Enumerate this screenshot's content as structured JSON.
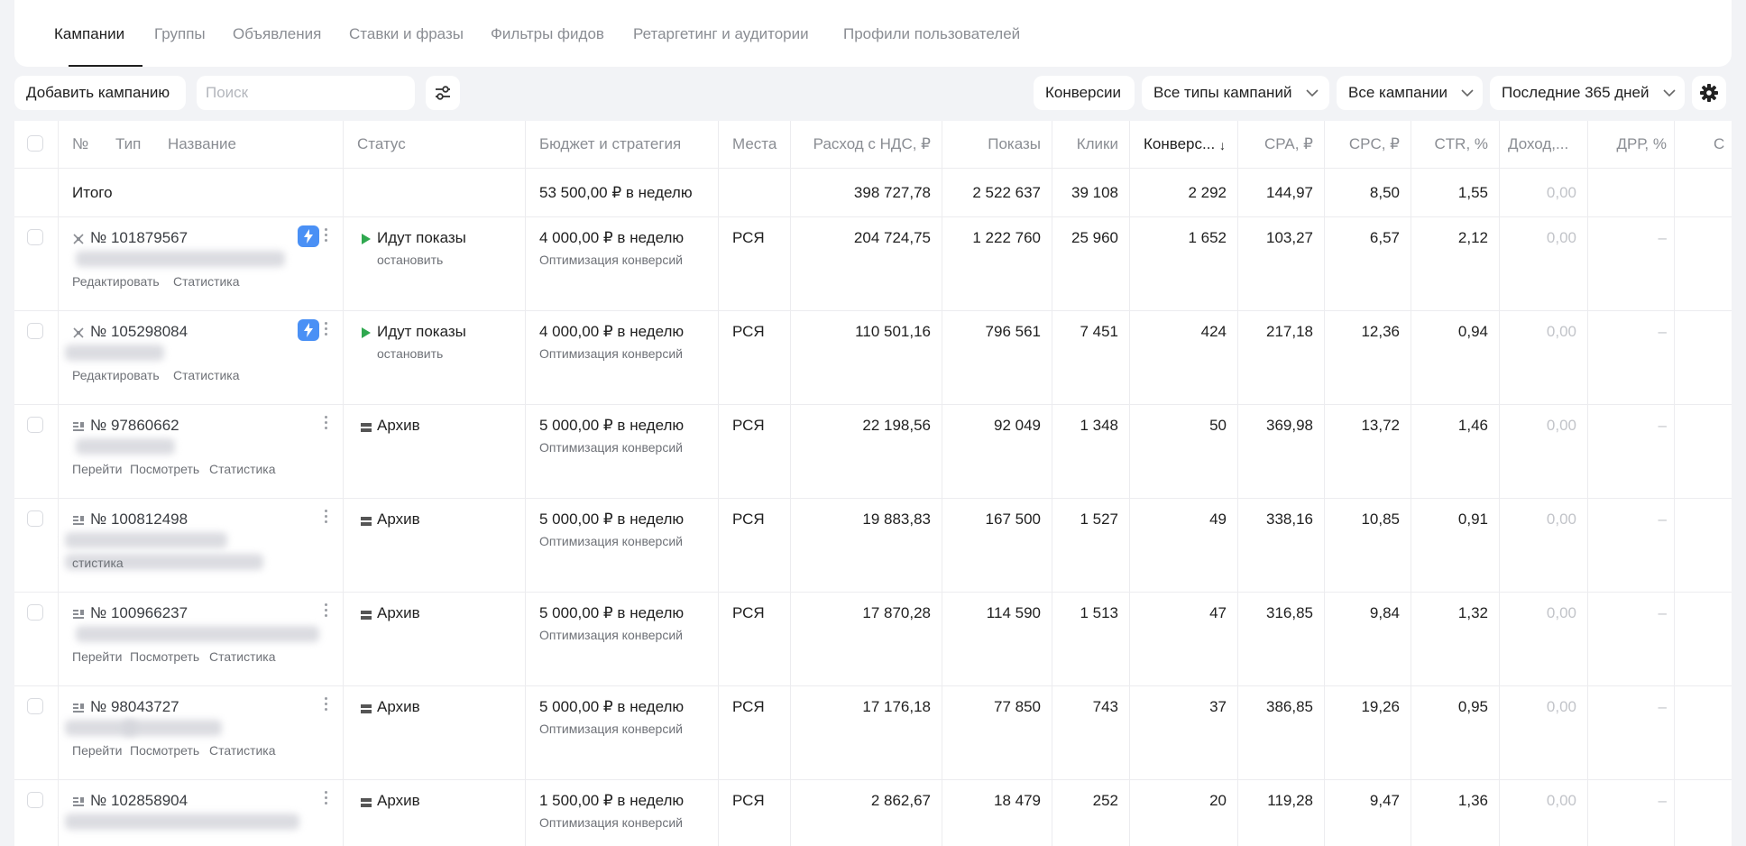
{
  "tabs": [
    "Кампании",
    "Группы",
    "Объявления",
    "Ставки и фразы",
    "Фильтры фидов",
    "Ретаргетинг и аудитории",
    "Профили пользователей"
  ],
  "toolbar": {
    "add_campaign": "Добавить кампанию",
    "search_placeholder": "Поиск",
    "conversions": "Конверсии",
    "campaign_types": "Все типы кампаний",
    "campaigns_filter": "Все кампании",
    "period": "Последние 365 дней"
  },
  "columns": {
    "num": "№",
    "type": "Тип",
    "name": "Название",
    "status": "Статус",
    "budget": "Бюджет и стратегия",
    "places": "Места",
    "spend": "Расход с НДС, ₽",
    "impressions": "Показы",
    "clicks": "Клики",
    "conversions": "Конверс...",
    "sort_arrow": "↓",
    "cpa": "CPA, ₽",
    "cpc": "CPC, ₽",
    "ctr": "CTR, %",
    "income": "Доход,...",
    "drr": "ДРР, %",
    "more": "С"
  },
  "totals": {
    "label": "Итого",
    "budget": "53 500,00 ₽ в неделю",
    "spend": "398 727,78",
    "impressions": "2 522 637",
    "clicks": "39 108",
    "conversions": "2 292",
    "cpa": "144,97",
    "cpc": "8,50",
    "ctr": "1,55",
    "income": "0,00"
  },
  "rows": [
    {
      "num": "№ 101879567",
      "type_icon": "smart-banner-icon",
      "links": [
        "Редактировать",
        "Статистика"
      ],
      "status": "Идут показы",
      "status_icon": "play-icon",
      "status_action": "остановить",
      "budget": "4 000,00 ₽ в неделю",
      "strategy": "Оптимизация конверсий",
      "places": "РСЯ",
      "spend": "204 724,75",
      "impressions": "1 222 760",
      "clicks": "25 960",
      "conversions": "1 652",
      "cpa": "103,27",
      "cpc": "6,57",
      "ctr": "2,12",
      "income": "0,00",
      "drr": "–",
      "has_bolt": true
    },
    {
      "num": "№ 105298084",
      "type_icon": "smart-banner-icon",
      "links": [
        "Редактировать",
        "Статистика"
      ],
      "status": "Идут показы",
      "status_icon": "play-icon",
      "status_action": "остановить",
      "budget": "4 000,00 ₽ в неделю",
      "strategy": "Оптимизация конверсий",
      "places": "РСЯ",
      "spend": "110 501,16",
      "impressions": "796 561",
      "clicks": "7 451",
      "conversions": "424",
      "cpa": "217,18",
      "cpc": "12,36",
      "ctr": "0,94",
      "income": "0,00",
      "drr": "–",
      "has_bolt": true
    },
    {
      "num": "№ 97860662",
      "type_icon": "text-ad-icon",
      "links": [
        "Перейти",
        "Посмотреть",
        "Статистика"
      ],
      "status": "Архив",
      "status_icon": "archive-icon",
      "status_action": "",
      "budget": "5 000,00 ₽ в неделю",
      "strategy": "Оптимизация конверсий",
      "places": "РСЯ",
      "spend": "22 198,56",
      "impressions": "92 049",
      "clicks": "1 348",
      "conversions": "50",
      "cpa": "369,98",
      "cpc": "13,72",
      "ctr": "1,46",
      "income": "0,00",
      "drr": "–",
      "has_bolt": false
    },
    {
      "num": "№ 100812498",
      "type_icon": "text-ad-icon",
      "links": [
        "",
        "",
        "стистика"
      ],
      "status": "Архив",
      "status_icon": "archive-icon",
      "status_action": "",
      "budget": "5 000,00 ₽ в неделю",
      "strategy": "Оптимизация конверсий",
      "places": "РСЯ",
      "spend": "19 883,83",
      "impressions": "167 500",
      "clicks": "1 527",
      "conversions": "49",
      "cpa": "338,16",
      "cpc": "10,85",
      "ctr": "0,91",
      "income": "0,00",
      "drr": "–",
      "has_bolt": false
    },
    {
      "num": "№ 100966237",
      "type_icon": "text-ad-icon",
      "links": [
        "Перейти",
        "Посмотреть",
        "Статистика"
      ],
      "status": "Архив",
      "status_icon": "archive-icon",
      "status_action": "",
      "budget": "5 000,00 ₽ в неделю",
      "strategy": "Оптимизация конверсий",
      "places": "РСЯ",
      "spend": "17 870,28",
      "impressions": "114 590",
      "clicks": "1 513",
      "conversions": "47",
      "cpa": "316,85",
      "cpc": "9,84",
      "ctr": "1,32",
      "income": "0,00",
      "drr": "–",
      "has_bolt": false
    },
    {
      "num": "№ 98043727",
      "type_icon": "text-ad-icon",
      "links": [
        "Перейти",
        "Посмотреть",
        "Статистика"
      ],
      "status": "Архив",
      "status_icon": "archive-icon",
      "status_action": "",
      "budget": "5 000,00 ₽ в неделю",
      "strategy": "Оптимизация конверсий",
      "places": "РСЯ",
      "spend": "17 176,18",
      "impressions": "77 850",
      "clicks": "743",
      "conversions": "37",
      "cpa": "386,85",
      "cpc": "19,26",
      "ctr": "0,95",
      "income": "0,00",
      "drr": "–",
      "has_bolt": false
    },
    {
      "num": "№ 102858904",
      "type_icon": "text-ad-icon",
      "links": [
        "",
        "",
        ""
      ],
      "status": "Архив",
      "status_icon": "archive-icon",
      "status_action": "",
      "budget": "1 500,00 ₽ в неделю",
      "strategy": "Оптимизация конверсий",
      "places": "РСЯ",
      "spend": "2 862,67",
      "impressions": "18 479",
      "clicks": "252",
      "conversions": "20",
      "cpa": "119,28",
      "cpc": "9,47",
      "ctr": "1,36",
      "income": "0,00",
      "drr": "–",
      "has_bolt": false
    }
  ],
  "colors": {
    "accent_blue": "#4a90f5",
    "play_green": "#2fa84f",
    "muted": "#c2c4c9",
    "text_secondary": "#8a8d93"
  }
}
